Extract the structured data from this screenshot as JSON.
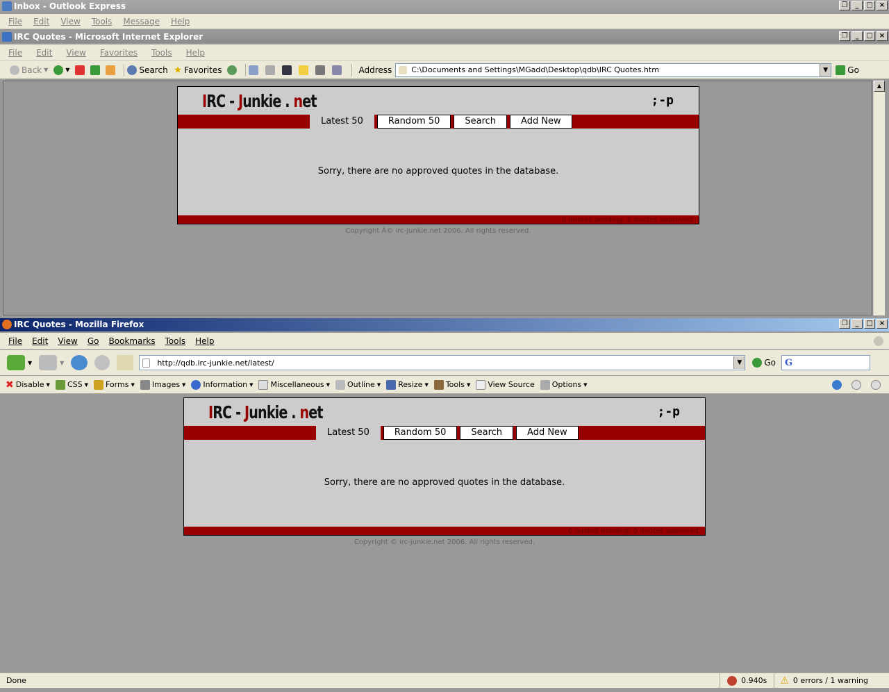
{
  "outlook": {
    "title": "Inbox - Outlook Express",
    "menu": [
      "File",
      "Edit",
      "View",
      "Tools",
      "Message",
      "Help"
    ]
  },
  "ie": {
    "title": "IRC Quotes - Microsoft Internet Explorer",
    "menu": [
      "File",
      "Edit",
      "View",
      "Favorites",
      "Tools",
      "Help"
    ],
    "toolbar": {
      "back": "Back",
      "search": "Search",
      "favorites": "Favorites"
    },
    "address_label": "Address",
    "address_value": "C:\\Documents and Settings\\MGadd\\Desktop\\qdb\\IRC Quotes.htm",
    "go_label": "Go"
  },
  "firefox": {
    "title": "IRC Quotes - Mozilla Firefox",
    "menu": [
      "File",
      "Edit",
      "View",
      "Go",
      "Bookmarks",
      "Tools",
      "Help"
    ],
    "url": "http://qdb.irc-junkie.net/latest/",
    "go_label": "Go",
    "devbar": [
      "Disable",
      "CSS",
      "Forms",
      "Images",
      "Information",
      "Miscellaneous",
      "Outline",
      "Resize",
      "Tools",
      "View Source",
      "Options"
    ],
    "status": {
      "text": "Done",
      "time": "0.940s",
      "errors": "0 errors / 1 warning"
    }
  },
  "site_ie": {
    "logo": {
      "i": "I",
      "rc": "RC - ",
      "j": "J",
      "unkie": "unkie . ",
      "n": "n",
      "et": "et"
    },
    "smiley": ";-p",
    "tabs": [
      "Latest 50",
      "Random 50",
      "Search",
      "Add New"
    ],
    "message": "Sorry, there are no approved quotes in the database.",
    "footer": "0 quotes pending, 0 quotes approved.",
    "copyright": "Copyright Â© irc-junkie.net 2006. All rights reserved."
  },
  "site_ff": {
    "logo": {
      "i": "I",
      "rc": "RC - ",
      "j": "J",
      "unkie": "unkie . ",
      "n": "n",
      "et": "et"
    },
    "smiley": ";-p",
    "tabs": [
      "Latest 50",
      "Random 50",
      "Search",
      "Add New"
    ],
    "message": "Sorry, there are no approved quotes in the database.",
    "footer": "0 quotes pending, 0 quotes approved.",
    "copyright": "Copyright © irc-junkie.net 2006. All rights reserved."
  },
  "colors": {
    "brand_red": "#990000",
    "panel_gray": "#cccccc",
    "page_gray": "#999999"
  }
}
